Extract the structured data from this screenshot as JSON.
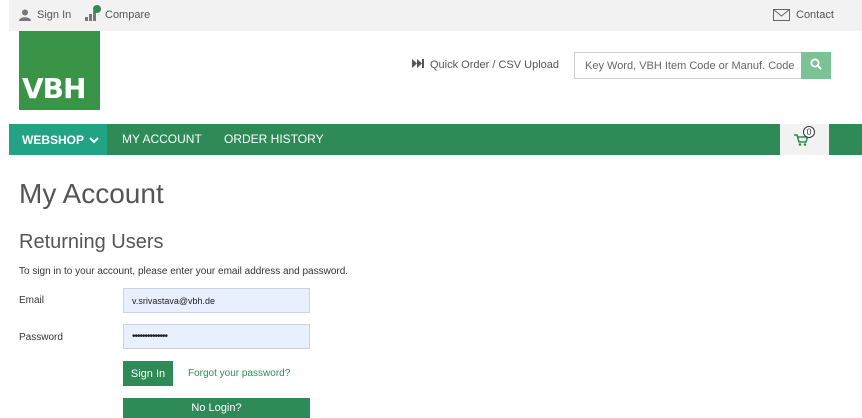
{
  "topbar": {
    "sign_in_label": "Sign In",
    "compare_label": "Compare",
    "contact_label": "Contact",
    "icons": [
      "user-icon",
      "compare-icon",
      "envelope-icon"
    ]
  },
  "header": {
    "logo_text": "VBH",
    "quick_order_label": "Quick Order / CSV Upload",
    "quick_order_icon": "skip-forward-icon",
    "search": {
      "placeholder": "Key Word, VBH Item Code or Manuf. Code",
      "button_icon": "search-icon"
    }
  },
  "nav": {
    "items": [
      {
        "label": "WEBSHOP"
      },
      {
        "label": "MY ACCOUNT"
      },
      {
        "label": "ORDER HISTORY"
      }
    ],
    "cart": {
      "icon": "cart-icon",
      "count": "0"
    }
  },
  "main": {
    "title": "My Account",
    "subtitle": "Returning Users",
    "instructions": "To sign in to your account, please enter your email address and password.",
    "email": {
      "label": "Email",
      "value": "v.srivastava@vbh.de"
    },
    "password": {
      "label": "Password",
      "value": "••••••••••••••"
    },
    "sign_in_button": "Sign In",
    "forgot_link": "Forgot your password?",
    "no_login_button": "No Login?"
  },
  "colors": {
    "brand_green": "#2e8b57",
    "webshop_teal": "#22a383",
    "logo_green": "#3a9447",
    "search_button": "#7cc297",
    "autofill_bg": "#e8f0fe",
    "topbar_bg": "#f2f2f2"
  }
}
